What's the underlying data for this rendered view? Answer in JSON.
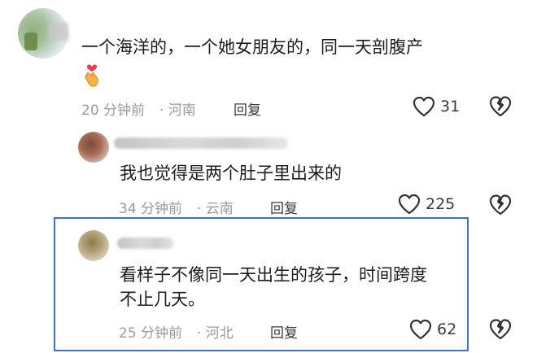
{
  "comments": [
    {
      "text": "一个海洋的，一个她女朋友的，同一天剖腹产",
      "time": "20 分钟前",
      "location": "· 河南",
      "reply_label": "回复",
      "likes": "31",
      "emoji": "hand-heart-icon"
    },
    {
      "text": "我也觉得是两个肚子里出来的",
      "time": "34 分钟前",
      "location": "· 云南",
      "reply_label": "回复",
      "likes": "225"
    },
    {
      "text_line1": "看样子不像同一天出生的孩子，时间跨度",
      "text_line2": "不止几天。",
      "time": "25 分钟前",
      "location": "· 河北",
      "reply_label": "回复",
      "likes": "62"
    }
  ],
  "colors": {
    "highlight_border": "#3d6fd6",
    "meta_text": "#9a9a9a",
    "body_text": "#1c1c1c"
  }
}
